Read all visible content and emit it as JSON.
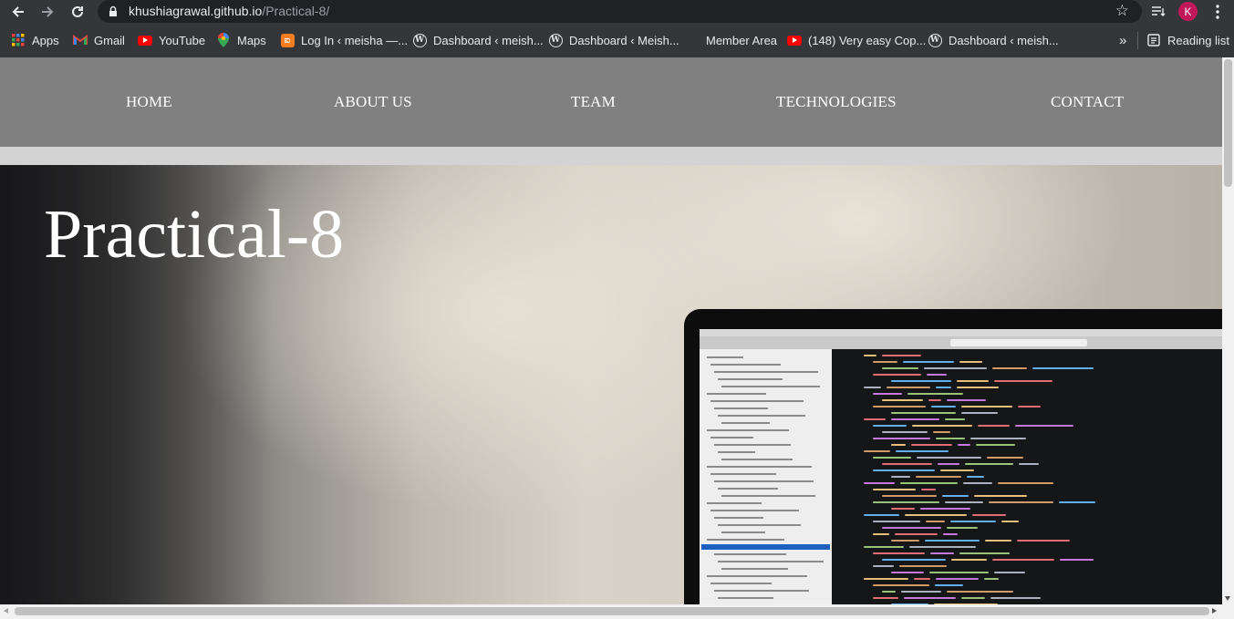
{
  "browser": {
    "url_domain": "khushiagrawal.github.io",
    "url_path": "/Practical-8/",
    "profile_initial": "K",
    "bookmarks": [
      {
        "label": "Apps",
        "icon": "apps-grid-icon"
      },
      {
        "label": "Gmail",
        "icon": "gmail-icon"
      },
      {
        "label": "YouTube",
        "icon": "youtube-icon"
      },
      {
        "label": "Maps",
        "icon": "maps-pin-icon"
      },
      {
        "label": "Log In ‹ meisha —...",
        "icon": "xampp-icon"
      },
      {
        "label": "Dashboard ‹ meish...",
        "icon": "wordpress-icon"
      },
      {
        "label": "Dashboard ‹ Meish...",
        "icon": "wordpress-icon"
      },
      {
        "label": "Member Area",
        "icon": ""
      },
      {
        "label": "(148) Very easy Cop...",
        "icon": "youtube-icon"
      },
      {
        "label": "Dashboard ‹ meish...",
        "icon": "wordpress-icon"
      }
    ],
    "more_bookmarks": "»",
    "reading_list": "Reading list"
  },
  "site": {
    "nav": [
      "HOME",
      "ABOUT US",
      "TEAM",
      "TECHNOLOGIES",
      "CONTACT"
    ],
    "hero_title": "Practical-8"
  },
  "colors": {
    "nav_bg": "#808080",
    "page_bg": "#d3d3d3",
    "avatar": "#c2185b"
  }
}
